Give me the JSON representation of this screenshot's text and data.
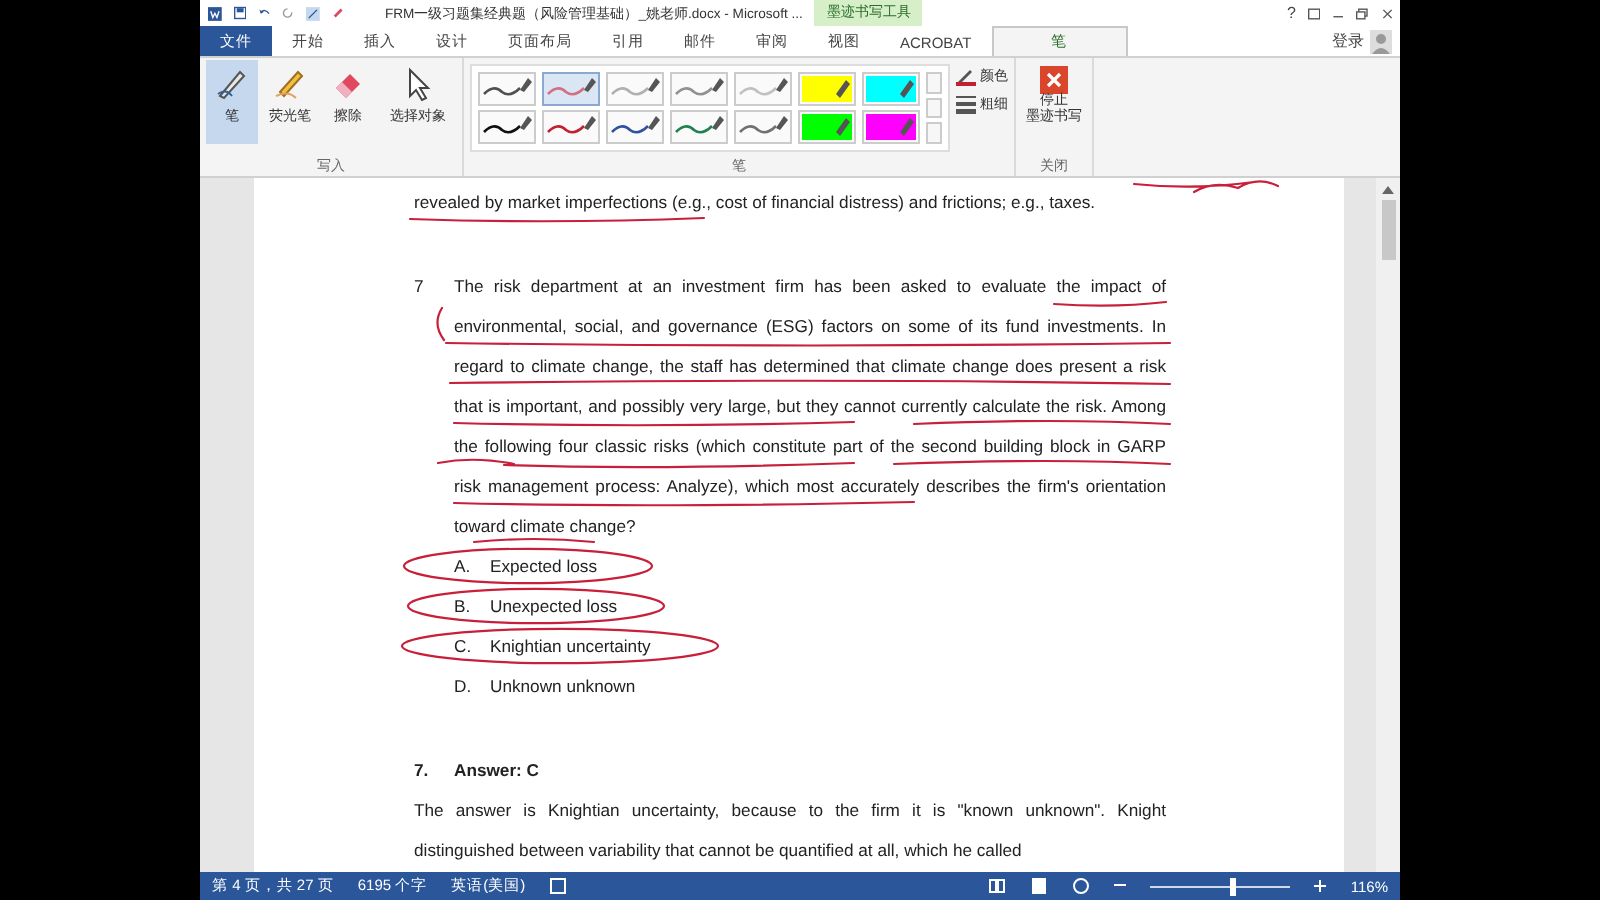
{
  "window": {
    "title": "FRM一级习题集经典题（风险管理基础）_姚老师.docx - Microsoft ...",
    "context_group": "墨迹书写工具",
    "help": "?",
    "sign_in": "登录"
  },
  "tabs": [
    {
      "label": "文件",
      "kind": "file",
      "selected": false
    },
    {
      "label": "开始",
      "kind": "tab",
      "selected": false
    },
    {
      "label": "插入",
      "kind": "tab",
      "selected": false
    },
    {
      "label": "设计",
      "kind": "tab",
      "selected": false
    },
    {
      "label": "页面布局",
      "kind": "tab",
      "selected": false
    },
    {
      "label": "引用",
      "kind": "tab",
      "selected": false
    },
    {
      "label": "邮件",
      "kind": "tab",
      "selected": false
    },
    {
      "label": "审阅",
      "kind": "tab",
      "selected": false
    },
    {
      "label": "视图",
      "kind": "tab",
      "selected": false
    },
    {
      "label": "ACROBAT",
      "kind": "tab",
      "selected": false
    },
    {
      "label": "笔",
      "kind": "context",
      "selected": true
    }
  ],
  "ribbon": {
    "write_group": {
      "label": "写入",
      "tools": [
        {
          "label": "笔",
          "kind": "pen",
          "selected": true
        },
        {
          "label": "荧光笔",
          "kind": "highlighter",
          "selected": false
        },
        {
          "label": "擦除",
          "kind": "eraser",
          "selected": false
        },
        {
          "label": "选择对象",
          "kind": "select",
          "selected": false
        }
      ]
    },
    "pen_group": {
      "label": "笔",
      "pens": [
        {
          "kind": "pen",
          "color": "#505050",
          "selected": false
        },
        {
          "kind": "pen",
          "color": "#d07080",
          "selected": true
        },
        {
          "kind": "pen",
          "color": "#b0b0b0",
          "selected": false
        },
        {
          "kind": "pen",
          "color": "#909090",
          "selected": false
        },
        {
          "kind": "pen",
          "color": "#c0c0c0",
          "selected": false
        },
        {
          "kind": "highlighter",
          "color": "#ffff00",
          "selected": false
        },
        {
          "kind": "highlighter",
          "color": "#00ffff",
          "selected": false
        },
        {
          "kind": "pen",
          "color": "#101010",
          "selected": false
        },
        {
          "kind": "pen",
          "color": "#c02030",
          "selected": false
        },
        {
          "kind": "pen",
          "color": "#3050a0",
          "selected": false
        },
        {
          "kind": "pen",
          "color": "#208050",
          "selected": false
        },
        {
          "kind": "pen",
          "color": "#707070",
          "selected": false
        },
        {
          "kind": "highlighter",
          "color": "#00ff00",
          "selected": false
        },
        {
          "kind": "highlighter",
          "color": "#ff00ff",
          "selected": false
        }
      ],
      "options": [
        {
          "label": "颜色",
          "kind": "color"
        },
        {
          "label": "粗细",
          "kind": "thickness"
        }
      ]
    },
    "close_group": {
      "label": "关闭",
      "button_lines": [
        "停止",
        "墨迹书写"
      ]
    }
  },
  "document": {
    "previous_text": "revealed by market imperfections (e.g., cost of financial distress) and frictions; e.g., taxes.",
    "question": {
      "number": "7",
      "text": "The risk department at an investment firm has been asked to evaluate the impact of environmental, social, and governance (ESG) factors on some of its fund investments. In regard to climate change, the staff has determined that climate change does present a risk that is important, and possibly very large, but they cannot currently calculate the risk. Among the following four classic risks (which constitute part of the second building block in GARP risk management process: Analyze), which most accurately describes the firm's orientation toward climate change?",
      "options": [
        {
          "letter": "A.",
          "text": "Expected loss"
        },
        {
          "letter": "B.",
          "text": "Unexpected loss"
        },
        {
          "letter": "C.",
          "text": "Knightian uncertainty"
        },
        {
          "letter": "D.",
          "text": "Unknown unknown"
        }
      ]
    },
    "answer": {
      "number": "7.",
      "heading": "Answer: C",
      "text": "The answer is Knightian uncertainty, because to the firm it is \"known unknown\". Knight distinguished between variability that cannot be quantified at all, which he called"
    }
  },
  "status_bar": {
    "page": "第 4 页，共 27 页",
    "words": "6195 个字",
    "language": "英语(美国)",
    "zoom": "116%",
    "zoom_slider": {
      "level": 0.56
    }
  }
}
